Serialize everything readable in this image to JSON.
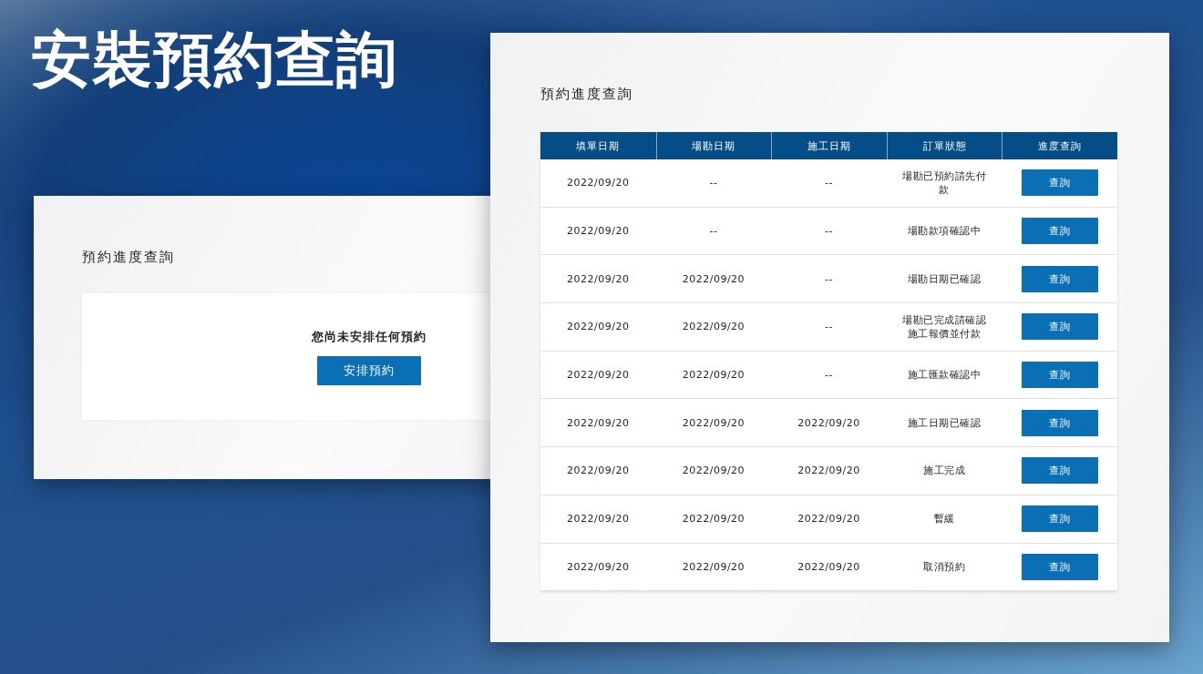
{
  "title": "安裝預約查詢",
  "empty_panel": {
    "heading": "預約進度查詢",
    "message": "您尚未安排任何預約",
    "button": "安排預約"
  },
  "orders_panel": {
    "heading": "預約進度查詢",
    "table": {
      "columns": [
        "填單日期",
        "場勘日期",
        "施工日期",
        "訂單狀態",
        "進度查詢"
      ],
      "rows": [
        {
          "cells": [
            "2022/09/20",
            "--",
            "--",
            "場勘已預約請先付款"
          ],
          "button": "查詢"
        },
        {
          "cells": [
            "2022/09/20",
            "--",
            "--",
            "場勘款項確認中"
          ],
          "button": "查詢"
        },
        {
          "cells": [
            "2022/09/20",
            "2022/09/20",
            "--",
            "場勘日期已確認"
          ],
          "button": "查詢"
        },
        {
          "cells": [
            "2022/09/20",
            "2022/09/20",
            "--",
            "場勘已完成請確認施工報價並付款"
          ],
          "button": "查詢"
        },
        {
          "cells": [
            "2022/09/20",
            "2022/09/20",
            "--",
            "施工匯款確認中"
          ],
          "button": "查詢"
        },
        {
          "cells": [
            "2022/09/20",
            "2022/09/20",
            "2022/09/20",
            "施工日期已確認"
          ],
          "button": "查詢"
        },
        {
          "cells": [
            "2022/09/20",
            "2022/09/20",
            "2022/09/20",
            "施工完成"
          ],
          "button": "查詢"
        },
        {
          "cells": [
            "2022/09/20",
            "2022/09/20",
            "2022/09/20",
            "暫緩"
          ],
          "button": "查詢"
        },
        {
          "cells": [
            "2022/09/20",
            "2022/09/20",
            "2022/09/20",
            "取消預約"
          ],
          "button": "查詢"
        }
      ]
    }
  }
}
